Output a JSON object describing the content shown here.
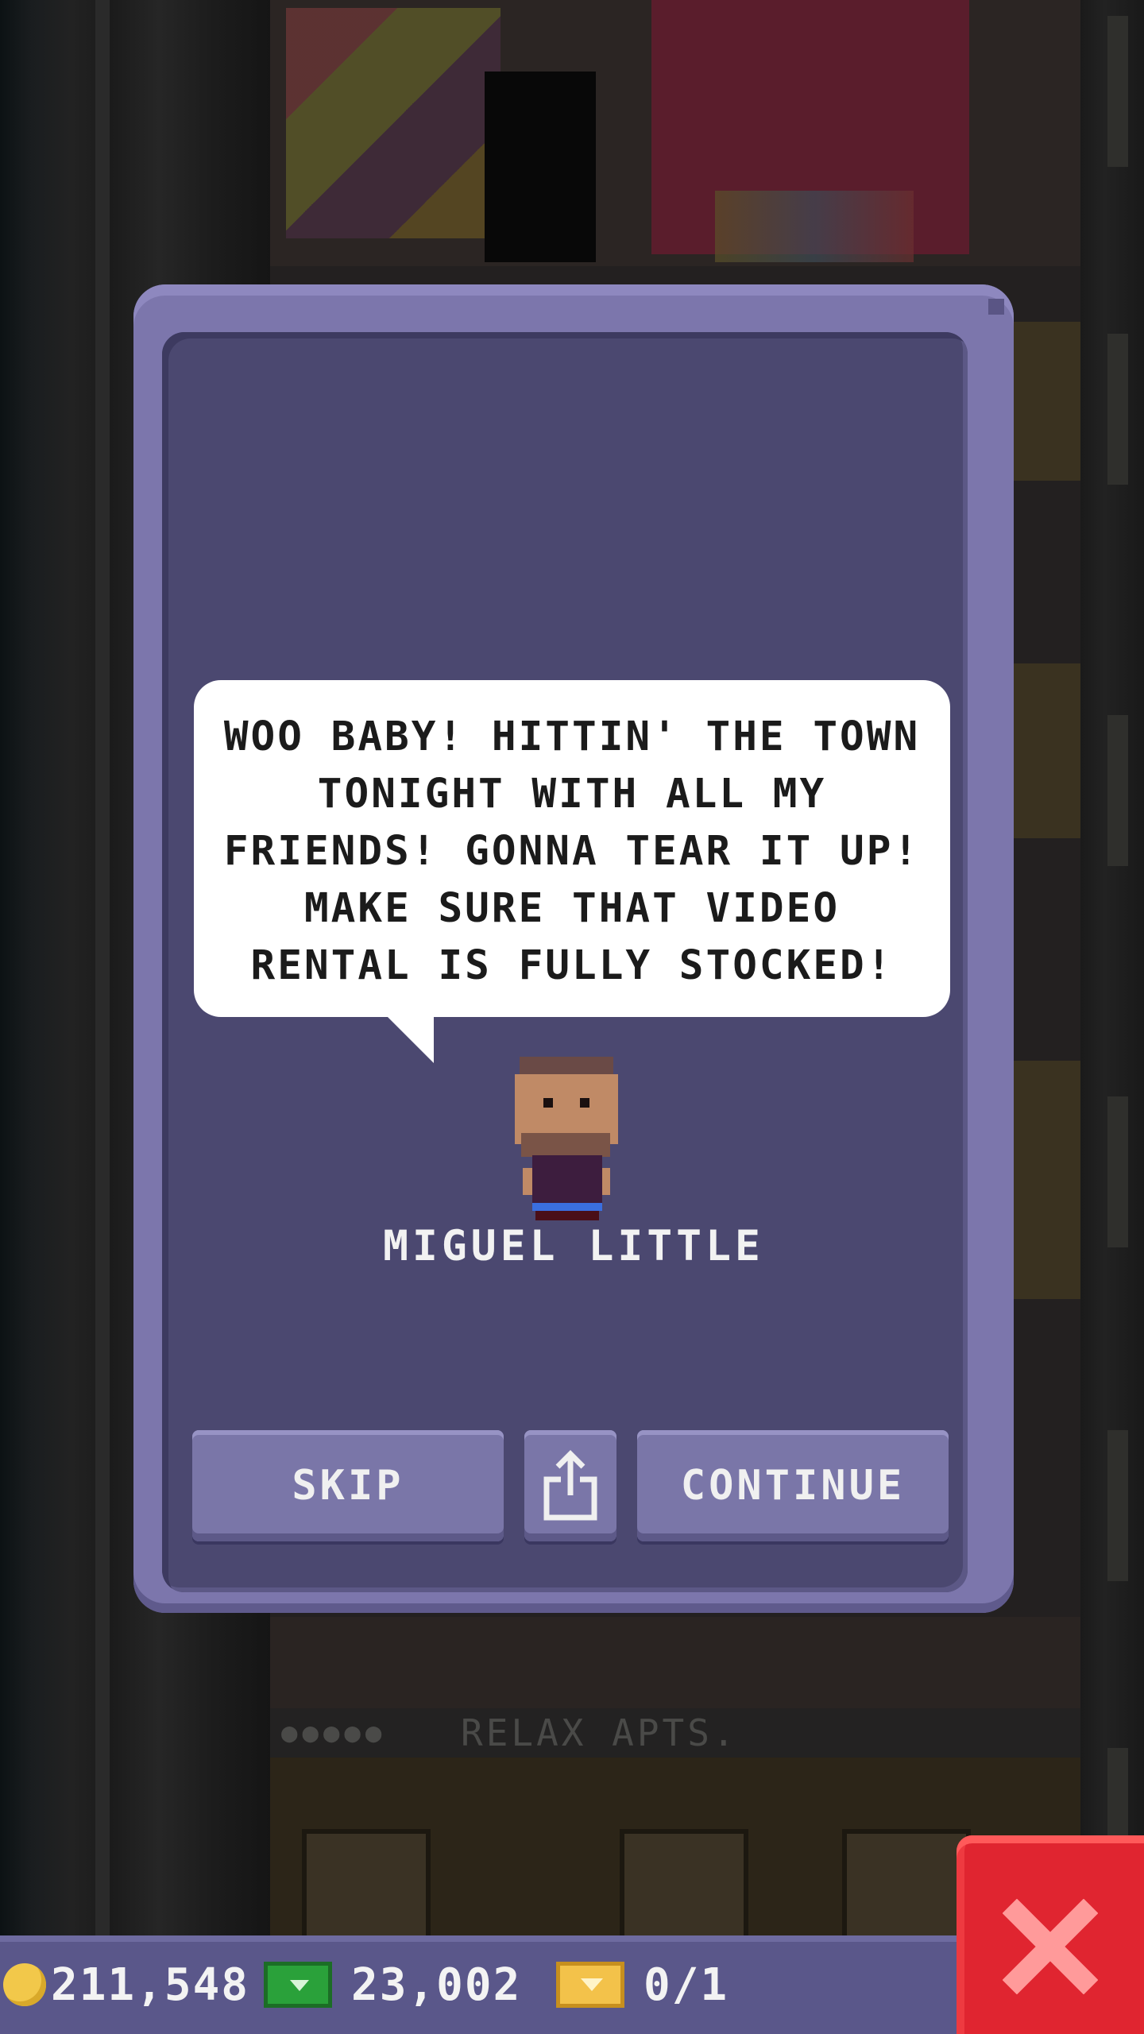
{
  "background": {
    "sign_label": "RELAX APTS."
  },
  "dialog": {
    "speech": "WOO BABY! HITTIN' THE TOWN TONIGHT WITH ALL MY FRIENDS! GONNA TEAR IT UP! MAKE SURE THAT VIDEO RENTAL IS FULLY STOCKED!",
    "character_name": "MIGUEL LITTLE",
    "buttons": {
      "skip": "SKIP",
      "share_icon": "share-icon",
      "continue": "CONTINUE"
    }
  },
  "resources": {
    "coins": "211,548",
    "bux": "23,002",
    "tickets": "0/1"
  },
  "close_icon": "close-icon",
  "colors": {
    "dialog_frame": "#7c76ac",
    "dialog_body": "#4b4870",
    "button": "#7a76a8",
    "close_button": "#e02530",
    "coin": "#f2c84a",
    "bux": "#2aa13a",
    "ticket": "#f3c24a"
  }
}
